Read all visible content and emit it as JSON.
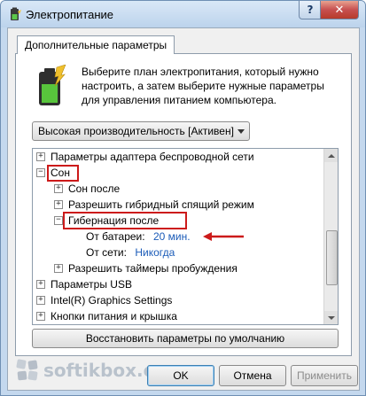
{
  "window": {
    "title": "Электропитание",
    "help_label": "?",
    "close_label": "✕"
  },
  "tab": {
    "label": "Дополнительные параметры"
  },
  "description": "Выберите план электропитания, который нужно настроить, а затем выберите нужные параметры для управления питанием компьютера.",
  "plan": {
    "selected": "Высокая производительность [Активен]"
  },
  "tree": {
    "items": [
      {
        "label": "Параметры адаптера беспроводной сети",
        "expander": "+"
      },
      {
        "label": "Сон",
        "expander": "−"
      },
      {
        "label": "Сон после",
        "expander": "+"
      },
      {
        "label": "Разрешить гибридный спящий режим",
        "expander": "+"
      },
      {
        "label": "Гибернация после",
        "expander": "−"
      },
      {
        "label": "От батареи:",
        "value": "20 мин."
      },
      {
        "label": "От сети:",
        "value": "Никогда"
      },
      {
        "label": "Разрешить таймеры пробуждения",
        "expander": "+"
      },
      {
        "label": "Параметры USB",
        "expander": "+"
      },
      {
        "label": "Intel(R) Graphics Settings",
        "expander": "+"
      },
      {
        "label": "Кнопки питания и крышка",
        "expander": "+"
      }
    ]
  },
  "buttons": {
    "restore": "Восстановить параметры по умолчанию",
    "ok": "OK",
    "cancel": "Отмена",
    "apply": "Применить"
  },
  "watermark": {
    "text": "softikbox.com"
  },
  "colors": {
    "highlight": "#cc1a1a",
    "link_value": "#1a5bb8",
    "close_button": "#c75050"
  }
}
